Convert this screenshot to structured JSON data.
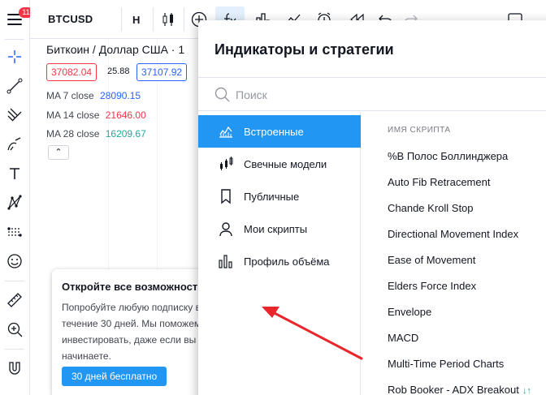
{
  "app": {
    "menu_badge": "11",
    "symbol": "BTCUSD",
    "interval": "H"
  },
  "chart": {
    "pair_title": "Биткоин / Доллар США · 1",
    "sell_price": "37082.04",
    "spread": "25.88",
    "buy_price": "37107.92",
    "ma": [
      {
        "label": "MA 7 close",
        "value": "28090.15",
        "color": "#2962ff"
      },
      {
        "label": "MA 14 close",
        "value": "21646.00",
        "color": "#f23645"
      },
      {
        "label": "MA 28 close",
        "value": "16209.67",
        "color": "#26a69a"
      }
    ],
    "collapse_glyph": "⌃"
  },
  "promo": {
    "title": "Откройте все возможности",
    "lines": [
      "Попробуйте любую подписку в",
      "течение 30 дней. Мы поможем",
      "инвестировать, даже если вы",
      "начинаете."
    ],
    "button": "30 дней бесплатно"
  },
  "dialog": {
    "title": "Индикаторы и стратегии",
    "search_placeholder": "Поиск",
    "categories": [
      {
        "label": "Встроенные",
        "icon": "builtin-chart-icon",
        "active": true
      },
      {
        "label": "Свечные модели",
        "icon": "candles-icon",
        "active": false
      },
      {
        "label": "Публичные",
        "icon": "bookmark-icon",
        "active": false
      },
      {
        "label": "Мои скрипты",
        "icon": "user-icon",
        "active": false
      },
      {
        "label": "Профиль объёма",
        "icon": "volume-profile-icon",
        "active": false
      }
    ],
    "column_header": "ИМЯ СКРИПТА",
    "scripts": [
      "%B Полос Боллинджера",
      "Auto Fib Retracement",
      "Chande Kroll Stop",
      "Directional Movement Index",
      "Ease of Movement",
      "Elders Force Index",
      "Envelope",
      "MACD",
      "Multi-Time Period Charts",
      "Rob Booker - ADX Breakout"
    ],
    "last_script_mark": "↓↑"
  },
  "colors": {
    "accent": "#2196f3",
    "sell": "#f23645",
    "buy": "#2962ff",
    "annotation_arrow": "#e8262b"
  }
}
